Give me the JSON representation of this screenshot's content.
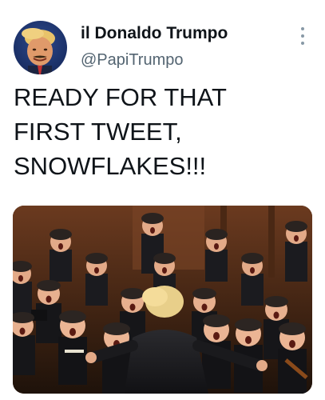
{
  "author": {
    "display_name": "il Donaldo Trumpo",
    "handle": "@PapiTrumpo",
    "avatar_icon": "profile-avatar"
  },
  "tweet": {
    "text_lines": [
      "READY FOR THAT",
      "FIRST TWEET,",
      "SNOWFLAKES!!!"
    ]
  },
  "menu": {
    "icon": "more-vertical-icon"
  },
  "media": {
    "kind": "photo",
    "description_icon": "choir-photo"
  },
  "colors": {
    "text": "#0f1419",
    "secondary": "#536471",
    "menu_dots": "#8899a6"
  }
}
